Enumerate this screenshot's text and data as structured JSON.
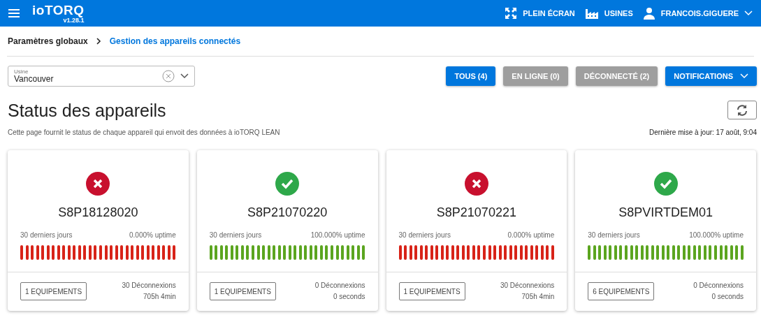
{
  "app_bar": {
    "logo": "ioTORQ",
    "version": "v1.28.1",
    "actions": [
      {
        "kind": "fullscreen",
        "label": "PLEIN ÉCRAN"
      },
      {
        "kind": "factory",
        "label": "USINES"
      },
      {
        "kind": "user",
        "label": "FRANCOIS.GIGUERE"
      }
    ]
  },
  "breadcrumb": [
    {
      "label": "Paramètres globaux",
      "selected": false
    },
    {
      "label": "Gestion des appareils connectés",
      "selected": true
    }
  ],
  "plant_select": {
    "label": "Usine",
    "value": "Vancouver"
  },
  "filters": [
    {
      "label": "TOUS (4)",
      "selected": true
    },
    {
      "label": "EN LIGNE (0)",
      "selected": false
    },
    {
      "label": "DÉCONNECTÉ (2)",
      "selected": false
    }
  ],
  "notifications_button": {
    "label": "NOTIFICATIONS"
  },
  "title": "Status des appareils",
  "subtitle": "Cette page fournit le status de chaque appareil qui envoit des données à ioTORQ LEAN",
  "last_update": "Dernière mise à jour: 17 août, 9:04",
  "devices": [
    {
      "name": "S8P18128020",
      "online": false,
      "period": "30 derniers jours",
      "uptime": "0.000% uptime",
      "equipment": "1 EQUIPEMENTS",
      "disconnections": "30 Déconnexions",
      "downtime": "705h 4min",
      "days": [
        false,
        false,
        false,
        false,
        false,
        false,
        false,
        false,
        false,
        false,
        false,
        false,
        false,
        false,
        false,
        false,
        false,
        false,
        false,
        false,
        false,
        false,
        false,
        false,
        false,
        false,
        false,
        false,
        false,
        false
      ]
    },
    {
      "name": "S8P21070220",
      "online": true,
      "period": "30 derniers jours",
      "uptime": "100.000% uptime",
      "equipment": "1 EQUIPEMENTS",
      "disconnections": "0 Déconnexions",
      "downtime": "0 seconds",
      "days": [
        true,
        true,
        true,
        true,
        true,
        true,
        true,
        true,
        true,
        true,
        true,
        true,
        true,
        true,
        true,
        true,
        true,
        true,
        true,
        true,
        true,
        true,
        true,
        true,
        true,
        true,
        true,
        true,
        true,
        true
      ]
    },
    {
      "name": "S8P21070221",
      "online": false,
      "period": "30 derniers jours",
      "uptime": "0.000% uptime",
      "equipment": "1 EQUIPEMENTS",
      "disconnections": "30 Déconnexions",
      "downtime": "705h 4min",
      "days": [
        false,
        false,
        false,
        false,
        false,
        false,
        false,
        false,
        false,
        false,
        false,
        false,
        false,
        false,
        false,
        false,
        false,
        false,
        false,
        false,
        false,
        false,
        false,
        false,
        false,
        false,
        false,
        false,
        false,
        false
      ]
    },
    {
      "name": "S8PVIRTDEM01",
      "online": true,
      "period": "30 derniers jours",
      "uptime": "100.000% uptime",
      "equipment": "6 EQUIPEMENTS",
      "disconnections": "0 Déconnexions",
      "downtime": "0 seconds",
      "days": [
        true,
        true,
        true,
        true,
        true,
        true,
        true,
        true,
        true,
        true,
        true,
        true,
        true,
        true,
        true,
        true,
        true,
        true,
        true,
        true,
        true,
        true,
        true,
        true,
        true,
        true,
        true,
        true,
        true,
        true
      ]
    }
  ]
}
